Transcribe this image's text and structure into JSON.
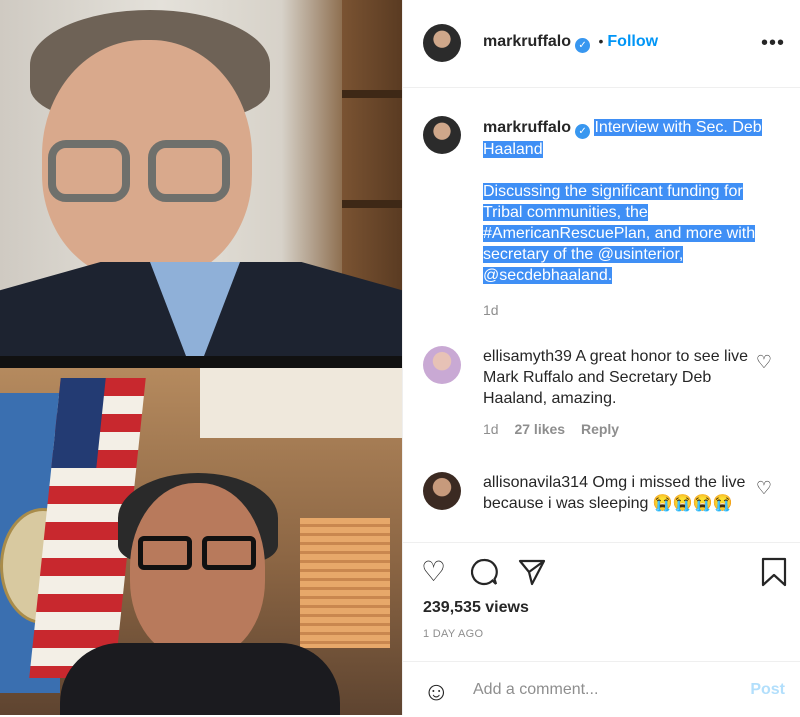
{
  "post": {
    "author": "markruffalo",
    "verified_icon": "verified-badge-icon",
    "follow_separator": "•",
    "follow_label": "Follow",
    "more_label": "•••"
  },
  "caption": {
    "author": "markruffalo",
    "title": "Interview with Sec. Deb Haaland",
    "body": "Discussing the significant funding for Tribal communities, the #AmericanRescuePlan, and more with secretary of the @usinterior, @secdebhaaland.",
    "time": "1d"
  },
  "comments": [
    {
      "user": "ellisamyth39",
      "text": "A great honor to see live Mark Ruffalo and Secretary Deb Haaland, amazing.",
      "time": "1d",
      "likes": "27 likes",
      "reply": "Reply"
    },
    {
      "user": "allisonavila314",
      "text": "Omg i missed the live because i was sleeping 😭😭😭😭"
    }
  ],
  "actions": {
    "like_icon": "heart-icon",
    "comment_icon": "comment-icon",
    "share_icon": "paper-plane-icon",
    "save_icon": "bookmark-icon",
    "views": "239,535 views",
    "posted": "1 DAY AGO"
  },
  "comment_box": {
    "emoji_icon": "smiley-icon",
    "placeholder": "Add a comment...",
    "post_label": "Post"
  },
  "colors": {
    "accent": "#0095f6",
    "highlight": "#3f8ff5",
    "muted": "#8e8e8e",
    "post_disabled": "#b2dffc"
  }
}
